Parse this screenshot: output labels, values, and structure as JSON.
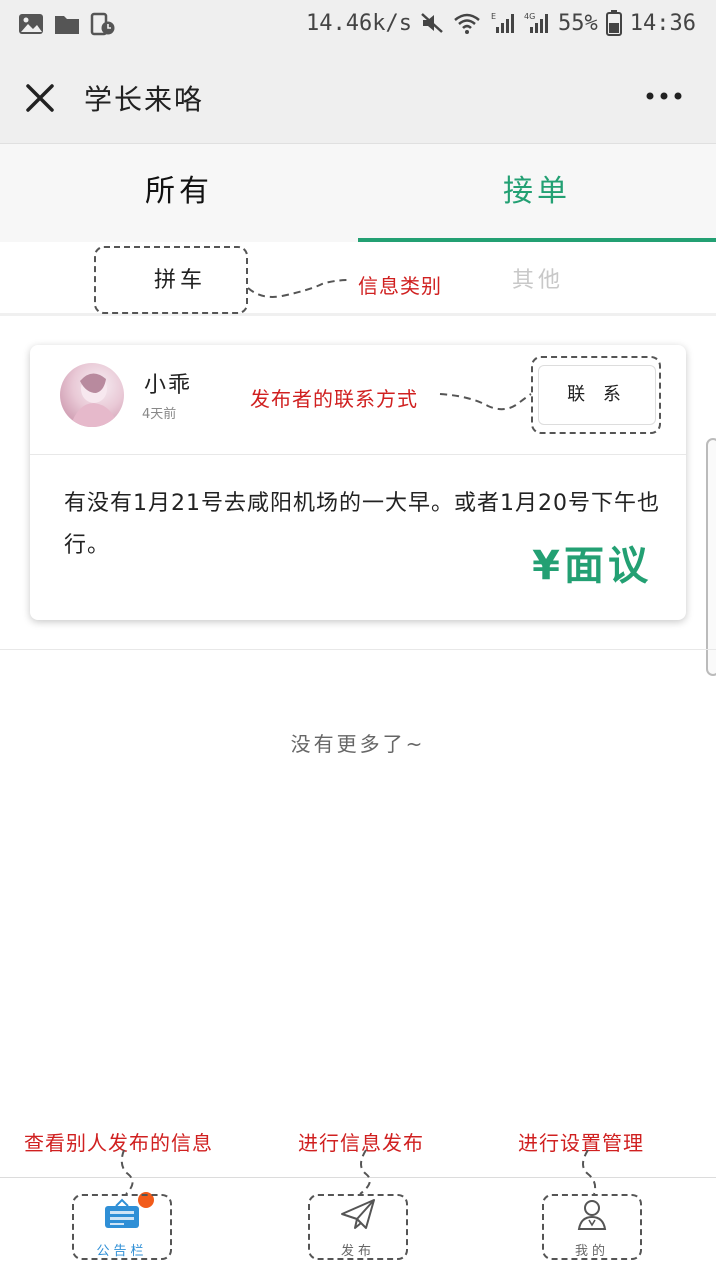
{
  "status_bar": {
    "net_speed": "14.46k/s",
    "battery": "55%",
    "time": "14:36",
    "icons": [
      "image-icon",
      "folder-icon",
      "clock-icon",
      "mute-icon",
      "wifi-icon",
      "signal-e-icon",
      "signal-4g-icon",
      "battery-icon"
    ]
  },
  "nav": {
    "title": "学长来咯",
    "close_icon": "close-icon",
    "more_icon": "more-icon"
  },
  "tabs": [
    {
      "label": "所有",
      "active": false
    },
    {
      "label": "接单",
      "active": true
    }
  ],
  "subcategories": [
    {
      "label": "拼车",
      "active": true
    },
    {
      "label": "其他",
      "active": false
    }
  ],
  "annotations": {
    "category": "信息类别",
    "contact": "发布者的联系方式",
    "view_others": "查看别人发布的信息",
    "publish": "进行信息发布",
    "settings": "进行设置管理"
  },
  "post": {
    "name": "小乖",
    "time_ago": "4天前",
    "contact_label": "联 系",
    "content": "有没有1月21号去咸阳机场的一大早。或者1月20号下午也行。",
    "price": "¥面议"
  },
  "list_end": "没有更多了~",
  "tab_bar": [
    {
      "label": "公告栏",
      "icon": "bulletin-icon",
      "active": true,
      "badge": true
    },
    {
      "label": "发布",
      "icon": "paper-plane-icon",
      "active": false,
      "badge": false
    },
    {
      "label": "我的",
      "icon": "user-icon",
      "active": false,
      "badge": false
    }
  ],
  "colors": {
    "accent_green": "#23a073",
    "annotation_red": "#d02020",
    "active_tab_blue": "#2f8fd6",
    "badge_orange": "#f25b1a"
  }
}
